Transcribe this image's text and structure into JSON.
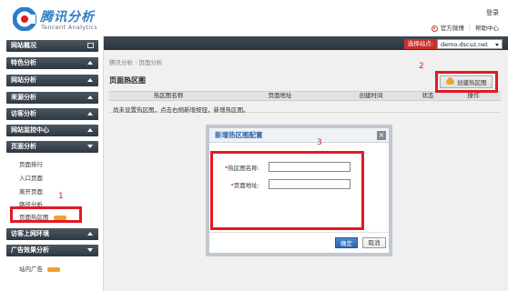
{
  "header": {
    "logo_cn": "腾讯分析",
    "logo_en": "Tencent Analytics",
    "login_label": "登录",
    "weibo_label": "官方微博",
    "help_label": "帮助中心",
    "separator": "|"
  },
  "topbar": {
    "site_label": "选择站点:",
    "site_value": "demo.dscuz.net"
  },
  "sidebar": {
    "sections": [
      {
        "label": "网站概况",
        "icon": "square-icon"
      },
      {
        "label": "特色分析",
        "icon": "chevron-up-icon"
      },
      {
        "label": "网站分析",
        "icon": "chevron-up-icon"
      },
      {
        "label": "来源分析",
        "icon": "chevron-up-icon"
      },
      {
        "label": "访客分析",
        "icon": "chevron-up-icon"
      },
      {
        "label": "网站监控中心",
        "icon": "chevron-up-icon"
      },
      {
        "label": "页面分析",
        "icon": "chevron-down-icon"
      }
    ],
    "page_items": [
      "页面排行",
      "入口页面",
      "离开页面",
      "路径分析",
      "页面热区图"
    ],
    "more_sections": [
      {
        "label": "访客上网环境",
        "icon": "chevron-up-icon"
      },
      {
        "label": "广告效果分析",
        "icon": "chevron-down-icon"
      }
    ],
    "ad_items": [
      "站内广告"
    ]
  },
  "main": {
    "breadcrumb": "腾讯分析 : 页面分析",
    "title": "页面热区图",
    "create_button": "创建热区图",
    "table": {
      "columns": [
        "热区图名称",
        "页面地址",
        "创建时间",
        "状态",
        "操作"
      ],
      "empty_message": "尚未设置热区图，点击右侧新增按钮，新增热区图。"
    }
  },
  "modal": {
    "title": "新增热区图配置",
    "close_glyph": "×",
    "name_label": "热区图名称:",
    "url_label": "页面地址:",
    "required_mark": "*",
    "name_value": "",
    "url_value": "",
    "ok_label": "确定",
    "cancel_label": "取消"
  },
  "annotations": {
    "step1": "1",
    "step2": "2",
    "step3": "3",
    "color": "#e11b22"
  },
  "colors": {
    "brand_blue": "#2c7fc7",
    "nav_dark": "#2f3842",
    "accent_red": "#c9302c",
    "hot_badge": "#f0a22e"
  }
}
